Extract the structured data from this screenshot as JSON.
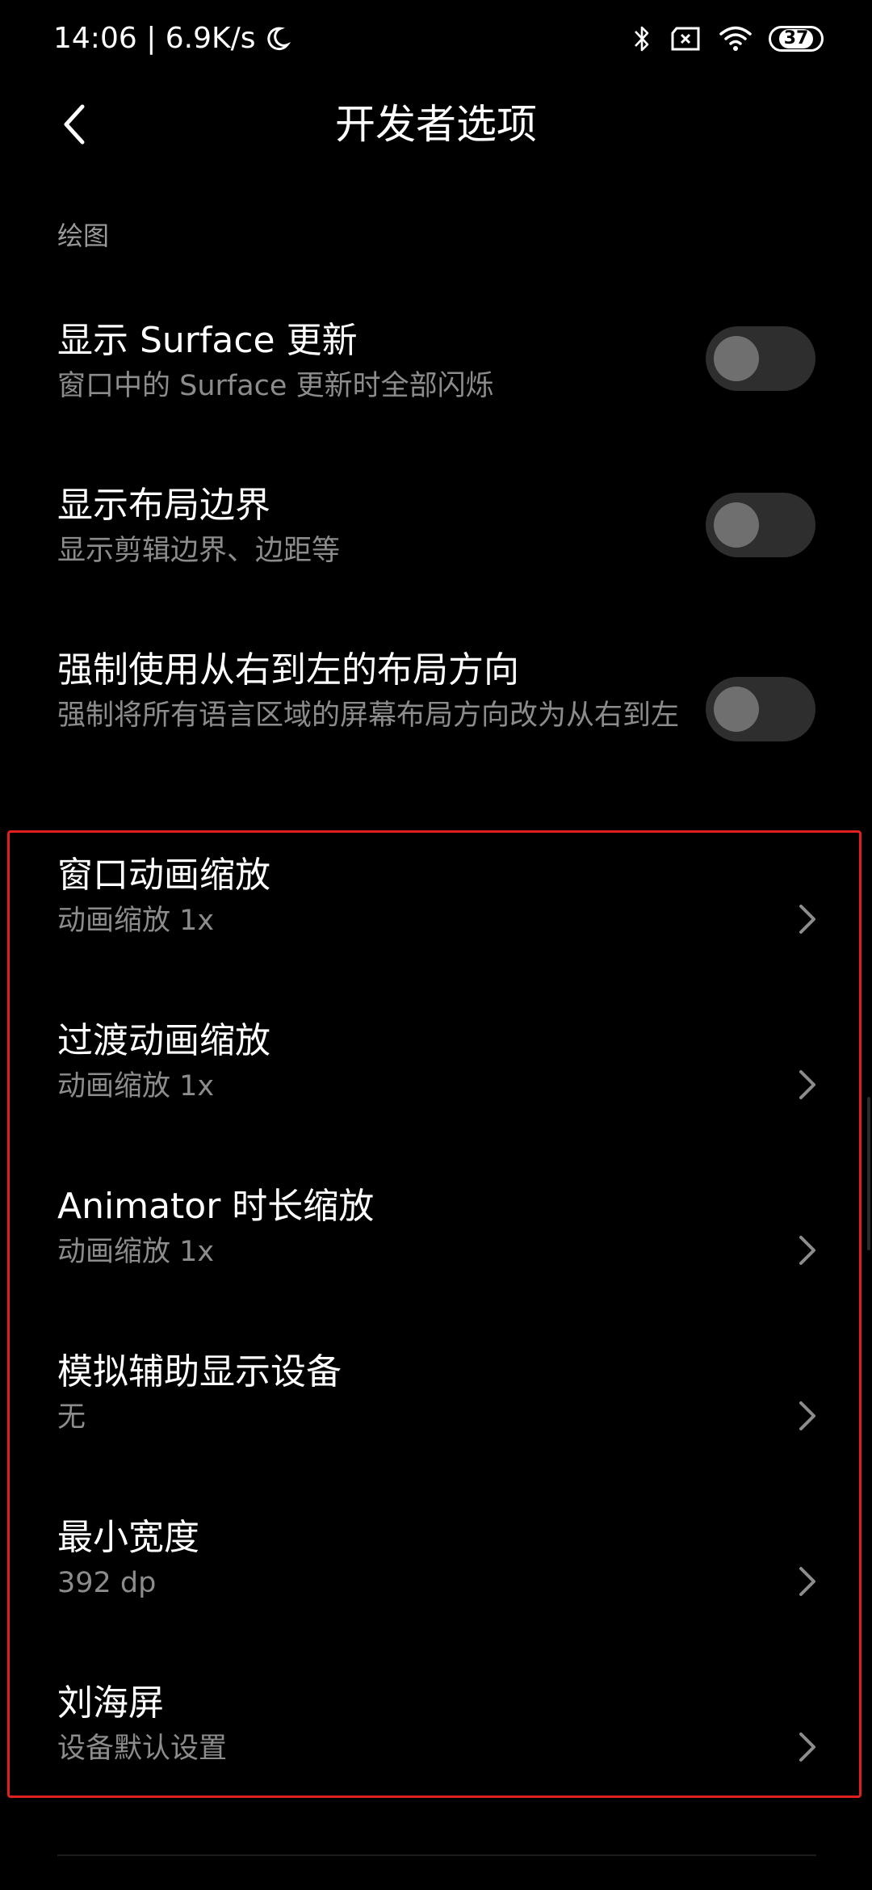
{
  "status_bar": {
    "time_speed": "14:06 | 6.9K/s",
    "battery_level": "37",
    "icons": [
      "moon-icon",
      "bluetooth-icon",
      "sim-icon",
      "wifi-icon",
      "battery-icon"
    ]
  },
  "header": {
    "title": "开发者选项",
    "back_icon": "chevron-left-icon"
  },
  "section": {
    "label": "绘图"
  },
  "toggles": [
    {
      "title": "显示 Surface 更新",
      "subtitle": "窗口中的 Surface 更新时全部闪烁",
      "on": false
    },
    {
      "title": "显示布局边界",
      "subtitle": "显示剪辑边界、边距等",
      "on": false
    },
    {
      "title": "强制使用从右到左的布局方向",
      "subtitle": "强制将所有语言区域的屏幕布局方向改为从右到左",
      "on": false
    }
  ],
  "nav_items": [
    {
      "title": "窗口动画缩放",
      "subtitle": "动画缩放 1x"
    },
    {
      "title": "过渡动画缩放",
      "subtitle": "动画缩放 1x"
    },
    {
      "title": "Animator 时长缩放",
      "subtitle": "动画缩放 1x"
    },
    {
      "title": "模拟辅助显示设备",
      "subtitle": "无"
    },
    {
      "title": "最小宽度",
      "subtitle": "392 dp"
    },
    {
      "title": "刘海屏",
      "subtitle": "设备默认设置"
    }
  ],
  "colors": {
    "background": "#000000",
    "title_text": "#ffffff",
    "subtitle_text": "#8c8c8c",
    "toggle_track": "#2e2e2e",
    "toggle_knob": "#6f6f6f",
    "highlight_border": "#e0201e"
  }
}
